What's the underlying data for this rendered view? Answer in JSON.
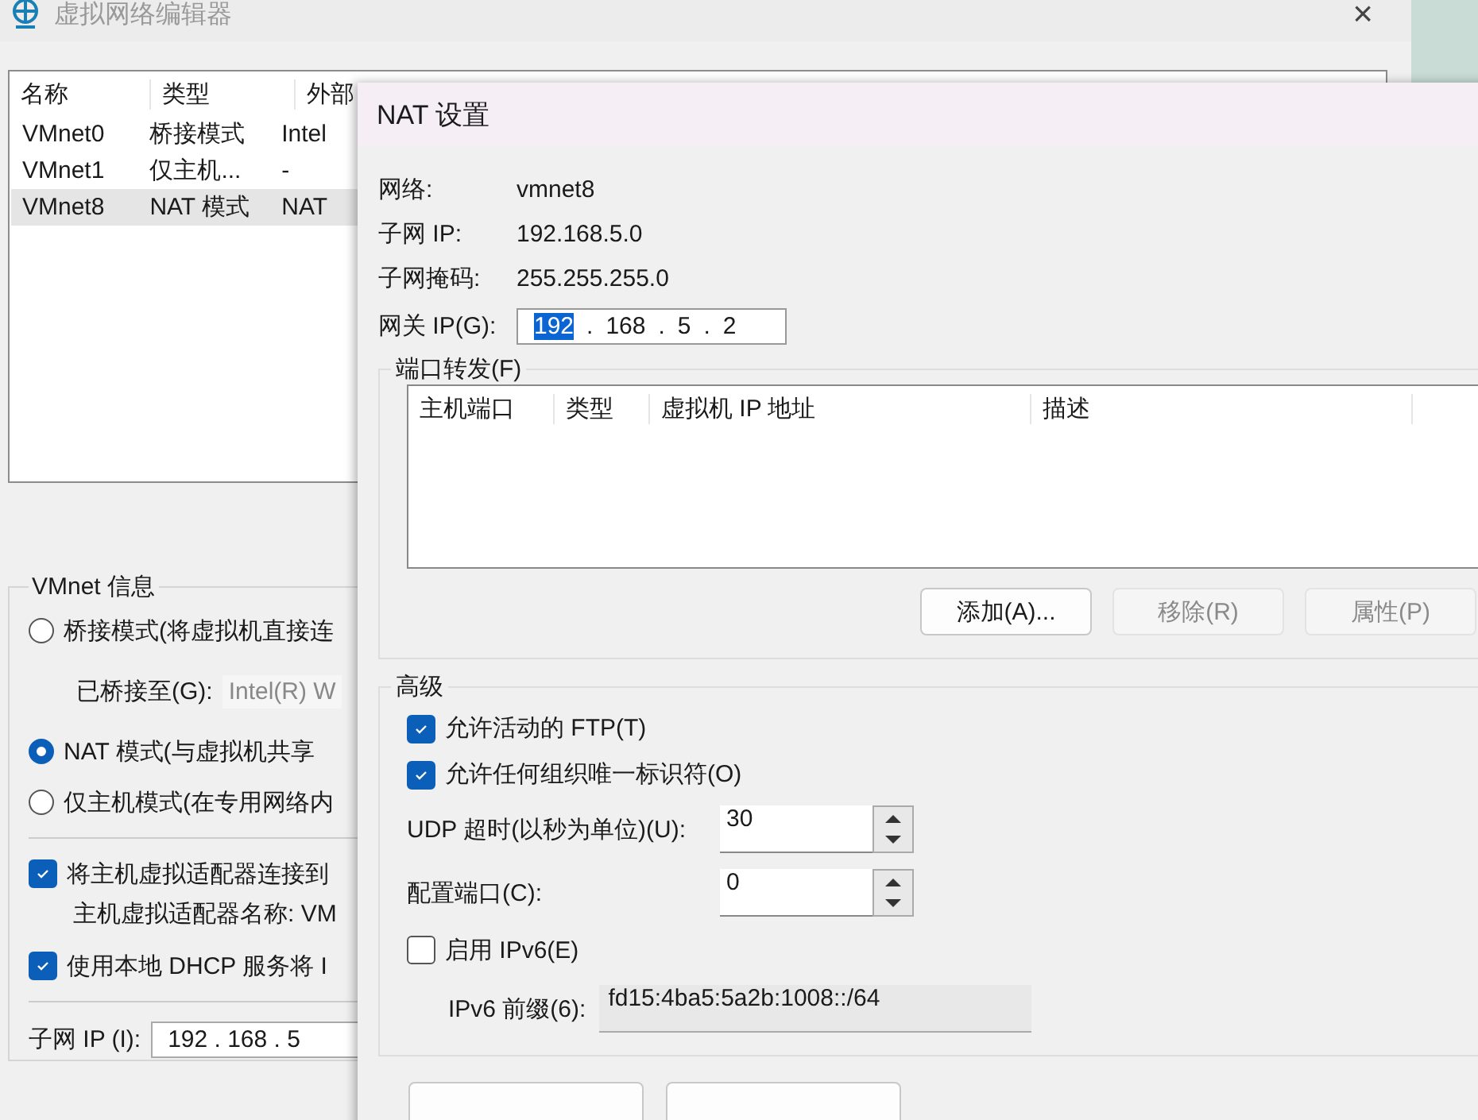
{
  "window": {
    "title": "虚拟网络编辑器",
    "close": "×"
  },
  "network_table": {
    "columns": [
      "名称",
      "类型",
      "外部"
    ],
    "rows": [
      {
        "cells": [
          "VMnet0",
          "桥接模式",
          "Intel"
        ],
        "selected": false
      },
      {
        "cells": [
          "VMnet1",
          "仅主机...",
          "-"
        ],
        "selected": false
      },
      {
        "cells": [
          "VMnet8",
          "NAT 模式",
          "NAT"
        ],
        "selected": true
      }
    ]
  },
  "vmnet_info": {
    "title": "VMnet 信息",
    "modes": [
      {
        "label": "桥接模式(将虚拟机直接连",
        "selected": false,
        "bridged_label": "已桥接至(G):",
        "bridged_value": "Intel(R) W"
      },
      {
        "label": "NAT 模式(与虚拟机共享",
        "selected": true
      },
      {
        "label": "仅主机模式(在专用网络内",
        "selected": false
      }
    ],
    "options": [
      {
        "label": "将主机虚拟适配器连接到",
        "checked": true,
        "note": "主机虚拟适配器名称: VM"
      },
      {
        "label": "使用本地 DHCP 服务将 I",
        "checked": true
      }
    ],
    "subnet_ip": {
      "label": "子网 IP (I):",
      "separator": ".",
      "octets": [
        "192",
        "168",
        "5"
      ]
    }
  },
  "nat_dialog": {
    "title": "NAT 设置",
    "info": [
      {
        "label": "网络:",
        "value": "vmnet8"
      },
      {
        "label": "子网 IP:",
        "value": "192.168.5.0"
      },
      {
        "label": "子网掩码:",
        "value": "255.255.255.0"
      }
    ],
    "gateway": {
      "label": "网关 IP(G):",
      "separator": ".",
      "octets": [
        {
          "text": "192",
          "selected": true
        },
        {
          "text": "168",
          "selected": false
        },
        {
          "text": "5",
          "selected": false
        },
        {
          "text": "2",
          "selected": false
        }
      ]
    },
    "port_forwarding": {
      "title": "端口转发(F)",
      "columns": [
        "主机端口",
        "类型",
        "虚拟机 IP 地址",
        "描述"
      ],
      "buttons": [
        {
          "label": "添加(A)...",
          "disabled": false
        },
        {
          "label": "移除(R)",
          "disabled": true
        },
        {
          "label": "属性(P)",
          "disabled": true
        }
      ]
    },
    "advanced": {
      "title": "高级",
      "checks": [
        {
          "label": "允许活动的 FTP(T)",
          "checked": true
        },
        {
          "label": "允许任何组织唯一标识符(O)",
          "checked": true
        }
      ],
      "spinners": [
        {
          "label": "UDP 超时(以秒为单位)(U):",
          "value": "30"
        },
        {
          "label": "配置端口(C):",
          "value": "0"
        }
      ],
      "ipv6": {
        "label": "启用 IPv6(E)",
        "checked": false
      },
      "prefix": {
        "label": "IPv6 前缀(6):",
        "value": "fd15:4ba5:5a2b:1008::/64"
      }
    }
  }
}
